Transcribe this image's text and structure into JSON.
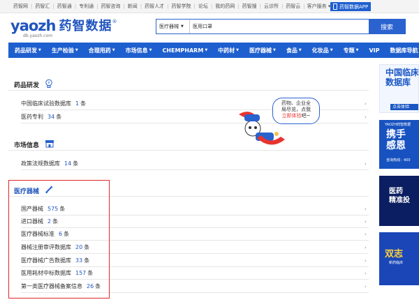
{
  "topbar": {
    "links": [
      "药智网",
      "药智汇",
      "药智通",
      "专利通",
      "药智咨询",
      "新闻",
      "药智人才",
      "药智学院",
      "论坛",
      "我的药网",
      "药智搜",
      "云诊所",
      "药智云"
    ],
    "service_label": "客户服务",
    "app_label": "药智数据APP"
  },
  "logo": {
    "en": "yaozh",
    "url": "db.yaozh.com",
    "cn": "药智数据",
    "reg": "®"
  },
  "search": {
    "category": "医疗器械",
    "value": "医用口罩",
    "button": "搜索"
  },
  "nav": {
    "items": [
      {
        "label": "药品研发",
        "dropdown": true
      },
      {
        "label": "生产检验",
        "dropdown": true
      },
      {
        "label": "合理用药",
        "dropdown": true
      },
      {
        "label": "市场信息",
        "dropdown": true
      },
      {
        "label": "CHEMPHARM",
        "dropdown": true
      },
      {
        "label": "中药材",
        "dropdown": true
      },
      {
        "label": "医疗器械",
        "dropdown": true
      },
      {
        "label": "食品",
        "dropdown": true
      },
      {
        "label": "化妆品",
        "dropdown": true
      },
      {
        "label": "专题",
        "dropdown": true
      },
      {
        "label": "VIP",
        "dropdown": false
      },
      {
        "label": "数据库导航",
        "dropdown": false
      }
    ]
  },
  "unit": "条",
  "sections": {
    "drug_rd": {
      "title": "药品研发",
      "rows": [
        {
          "label": "中国临床试验数据库",
          "count": "1"
        },
        {
          "label": "医药专利",
          "count": "34"
        }
      ]
    },
    "market": {
      "title": "市场信息",
      "rows": [
        {
          "label": "政策法规数据库",
          "count": "14"
        }
      ]
    },
    "device": {
      "title": "医疗器械",
      "rows": [
        {
          "label": "国产器械",
          "count": "575"
        },
        {
          "label": "进口器械",
          "count": "2"
        },
        {
          "label": "医疗器械标准",
          "count": "6"
        },
        {
          "label": "器械注册审评数据库",
          "count": "20"
        },
        {
          "label": "医疗器械广告数据库",
          "count": "33"
        },
        {
          "label": "医用耗材中标数据库",
          "count": "157"
        },
        {
          "label": "第一类医疗器械备案信息",
          "count": "26"
        }
      ]
    }
  },
  "bubble": {
    "line1": "药物、企业全",
    "line2": "局尽览，点我",
    "cta": "立即体验",
    "tail": "吧~"
  },
  "ads": {
    "ad1": {
      "line1": "中国临床",
      "line2": "数据库",
      "button": "点击体验"
    },
    "ad2": {
      "small": "YAOZH药智数据",
      "line1": "携手",
      "line2": "感恩",
      "phone": "咨询热线：400"
    },
    "ad3": {
      "line1": "医药",
      "line2": "精准投"
    },
    "ad4": {
      "title": "双志",
      "sub": "新药临床"
    }
  },
  "colors": {
    "brand_blue": "#1e5fcf",
    "count_blue": "#2155bf",
    "highlight_red": "#e0262b"
  }
}
